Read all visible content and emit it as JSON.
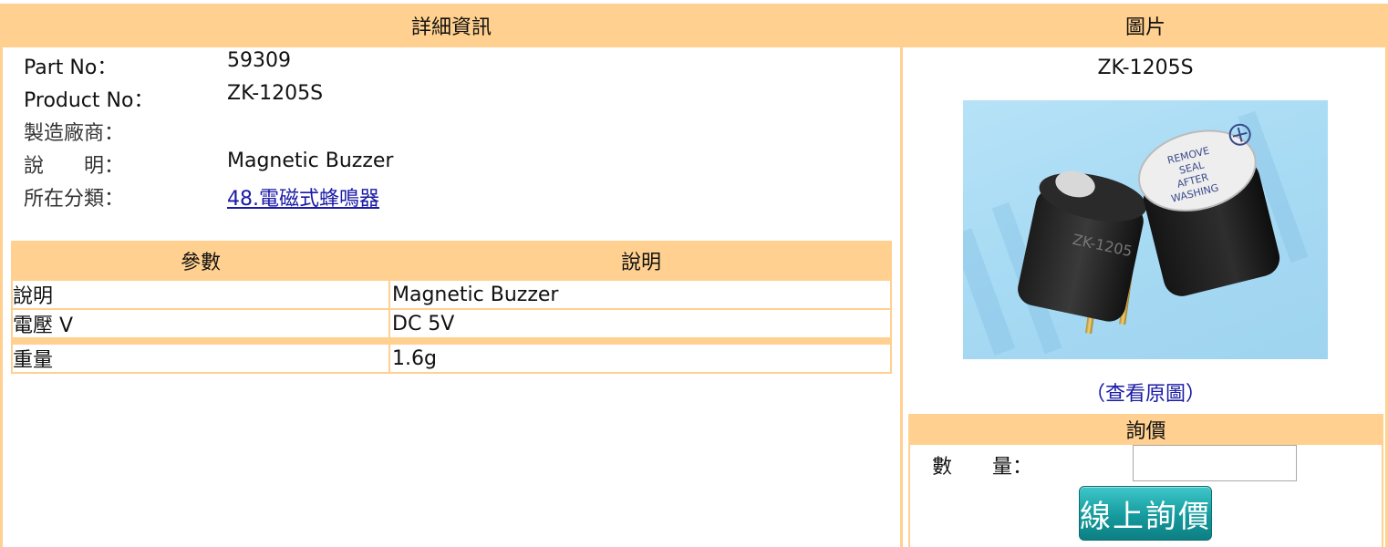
{
  "detail": {
    "header": "詳細資訊",
    "rows": [
      {
        "label": "Part No：",
        "value": "59309"
      },
      {
        "label": "Product No：",
        "value": "ZK-1205S"
      },
      {
        "label": "製造廠商：",
        "value": ""
      },
      {
        "label": "說　　明：",
        "value": "Magnetic Buzzer"
      },
      {
        "label": "所在分類：",
        "value": "48.電磁式蜂鳴器"
      }
    ]
  },
  "params": {
    "headers": [
      "參數",
      "說明"
    ],
    "rows": [
      [
        "說明",
        "Magnetic Buzzer"
      ],
      [
        "電壓 V",
        "DC 5V"
      ],
      [
        "重量",
        "1.6g"
      ]
    ]
  },
  "picture": {
    "header": "圖片",
    "product_name": "ZK-1205S",
    "view_original": "（查看原圖）"
  },
  "inquiry": {
    "header": "詢價",
    "quantity_label": "數　　量：",
    "quantity_value": "",
    "button_label": "線上詢價"
  },
  "colors": {
    "header_bg": "#ffd08f",
    "link": "#1a1aa6",
    "button": "#159a9d"
  }
}
